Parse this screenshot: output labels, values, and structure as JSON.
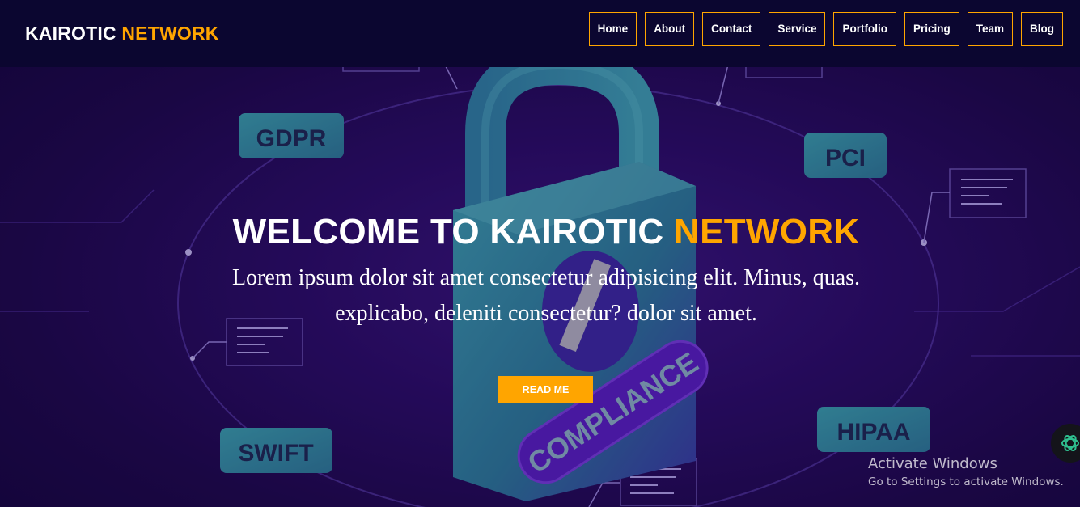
{
  "brand": {
    "word1": "KAIROTIC",
    "word2": "NETWORK"
  },
  "nav": {
    "items": [
      {
        "label": "Home"
      },
      {
        "label": "About"
      },
      {
        "label": "Contact"
      },
      {
        "label": "Service"
      },
      {
        "label": "Portfolio"
      },
      {
        "label": "Pricing"
      },
      {
        "label": "Team"
      },
      {
        "label": "Blog"
      }
    ]
  },
  "hero": {
    "title_part1": "WELCOME TO KAIROTIC",
    "title_part2": "NETWORK",
    "lead": "Lorem ipsum dolor sit amet consectetur adipisicing elit. Minus, quas. explicabo, deleniti consectetur? dolor sit amet.",
    "cta_label": "READ ME",
    "art": {
      "badges": [
        "GDPR",
        "PCI",
        "SWIFT",
        "HIPAA"
      ],
      "lock_band": "COMPLIANCE"
    }
  },
  "watermark": {
    "line1": "Activate Windows",
    "line2": "Go to Settings to activate Windows."
  },
  "icons": {
    "extension": "openai-logo-icon"
  },
  "colors": {
    "accent": "#ffa500",
    "navbar": "#0b0630",
    "background": "#2a0d66",
    "badge": "#2a8fa0"
  }
}
